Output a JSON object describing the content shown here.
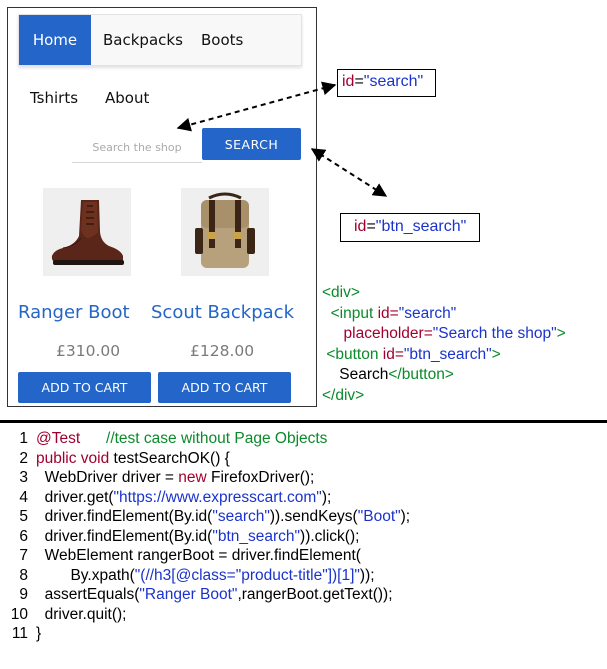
{
  "shop": {
    "nav": {
      "home": "Home",
      "backpacks": "Backpacks",
      "boots": "Boots",
      "tshirts": "Tshirts",
      "about": "About"
    },
    "search": {
      "placeholder": "Search the shop",
      "button": "SEARCH"
    },
    "products": [
      {
        "title": "Ranger Boot",
        "price": "£310.00",
        "button": "ADD TO CART",
        "icon": "boot-image"
      },
      {
        "title": "Scout Backpack",
        "price": "£128.00",
        "button": "ADD TO CART",
        "icon": "backpack-image"
      }
    ],
    "accent_color": "#2365c8"
  },
  "callouts": {
    "search": {
      "attr": "id",
      "eq": "=",
      "value": "\"search\""
    },
    "btn_search": {
      "attr": "id",
      "eq": "=",
      "value": "\"btn_search\""
    }
  },
  "html_snippet": {
    "div_open": "<div>",
    "input_open": "<input ",
    "input_id_attr": "id=",
    "input_id_val": "\"search\"",
    "placeholder_attr": "placeholder=",
    "placeholder_val": "\"Search the shop\"",
    "input_close": ">",
    "button_open": "<button ",
    "button_id_attr": "id=",
    "button_id_val": "\"btn_search\"",
    "button_close": ">",
    "button_text": "Search",
    "button_end": "</button>",
    "div_close": "</div>"
  },
  "code": {
    "l1_annotation": "@Test",
    "l1_comment": "//test case without Page Objects",
    "l2_kw": "public void",
    "l2_rest": " testSearchOK() {",
    "l3_a": "WebDriver driver = ",
    "l3_kw": "new",
    "l3_b": " FirefoxDriver();",
    "l4_a": "driver.get(",
    "l4_str": "\"https://www.expresscart.com\"",
    "l4_b": ");",
    "l5_a": "driver.findElement(By.id(",
    "l5_str1": "\"search\"",
    "l5_b": ")).sendKeys(",
    "l5_str2": "\"Boot\"",
    "l5_c": ");",
    "l6_a": "driver.findElement(By.id(",
    "l6_str": "\"btn_search\"",
    "l6_b": ")).click();",
    "l7": "WebElement rangerBoot = driver.findElement(",
    "l8_a": "By.xpath(",
    "l8_str": "\"(//h3[@class=\"product-title\"])[1]\"",
    "l8_b": "));",
    "l9_a": "assertEquals(",
    "l9_str": "\"Ranger Boot\"",
    "l9_b": ",rangerBoot.getText());",
    "l10": "driver.quit();",
    "l11": "}",
    "line_numbers": [
      "1",
      "2",
      "3",
      "4",
      "5",
      "6",
      "7",
      "8",
      "9",
      "10",
      "11"
    ]
  },
  "colors": {
    "keyword": "#a00030",
    "string": "#1a33cc",
    "comment": "#0b8a2b"
  }
}
